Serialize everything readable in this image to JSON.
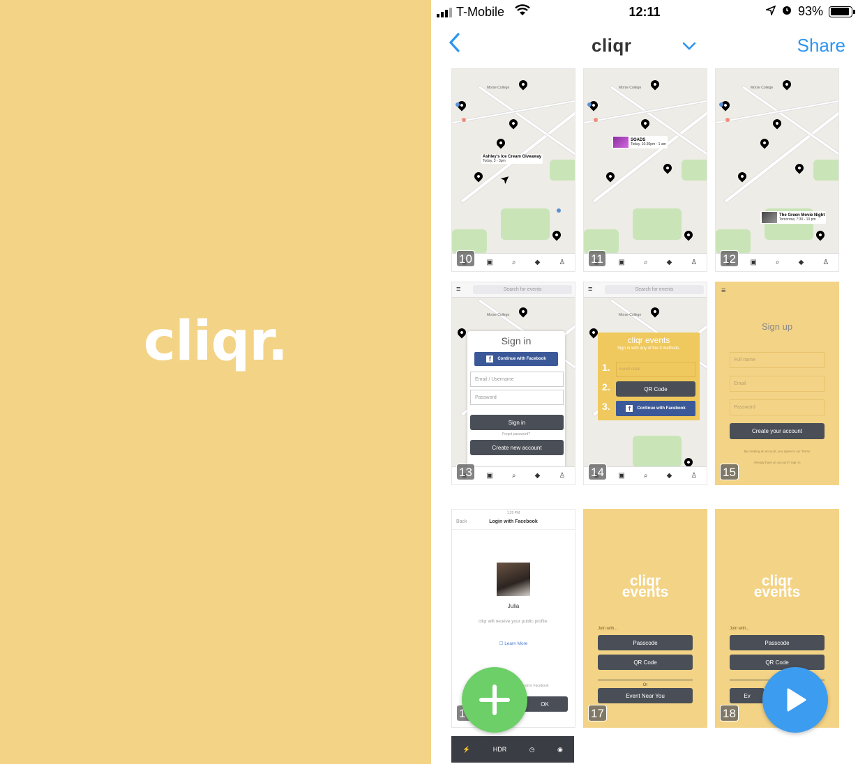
{
  "splash": {
    "logo": "cliqr."
  },
  "status": {
    "carrier": "T-Mobile",
    "time": "12:11",
    "battery": "93%",
    "battery_level": 0.93
  },
  "nav": {
    "back": "‹",
    "title": "cliqr",
    "chevron": "⌄",
    "share": "Share"
  },
  "tiles": {
    "t10": {
      "num": "10",
      "callout_title": "Ashley's Ice Cream Giveaway",
      "callout_sub": "Today, 3 - 3pm"
    },
    "t11": {
      "num": "11",
      "callout_title": "SOADS",
      "callout_sub": "Today, 10:30pm - 1 am"
    },
    "t12": {
      "num": "12",
      "callout_title": "The Green Movie Night",
      "callout_sub": "Tomorrow, 7:30 - 10 pm"
    },
    "t13": {
      "num": "13",
      "search": "Search for events",
      "title": "Sign in",
      "fb": "Continue with Facebook",
      "user": "Email / Username",
      "pass": "Password",
      "signin": "Sign in",
      "forgot": "Forgot password?",
      "create": "Create new account"
    },
    "t14": {
      "num": "14",
      "search": "Search for events",
      "title": "cliqr events",
      "sub": "Sign in with any of the 3 methods.",
      "n1": "1.",
      "n2": "2.",
      "n3": "3.",
      "code": "Event code",
      "qr": "QR Code",
      "fb": "Continue with Facebook"
    },
    "t15": {
      "num": "15",
      "title": "Sign up",
      "full": "Full name",
      "email": "Email",
      "pass": "Password",
      "create": "Create your account",
      "terms": "By creating an account, you agree to our Terms",
      "have": "Already have an account? Sign in"
    },
    "t16": {
      "num": "16",
      "status_time": "1:20 PM",
      "back": "Back",
      "head": "Login with Facebook",
      "name": "Julia",
      "desc": "cliqr will receive your public profile.",
      "learn": "Learn More",
      "ok": "OK",
      "foot": "ed to Facebook"
    },
    "t17": {
      "num": "17",
      "w1": "cliqr",
      "w2": "events",
      "join": "Join with...",
      "pass": "Passcode",
      "qr": "QR Code",
      "or": "Or",
      "near": "Event Near You"
    },
    "t18": {
      "num": "18",
      "w1": "cliqr",
      "w2": "events",
      "join": "Join with...",
      "pass": "Passcode",
      "qr": "QR Code",
      "near": "Ev"
    }
  },
  "tabbar": {
    "labels": [
      "Join",
      "Create",
      "Find",
      "Tags",
      "Account"
    ]
  },
  "camera": {
    "hdr": "HDR"
  },
  "icons": {
    "back": "chevron-left-icon",
    "chevron": "chevron-down-icon",
    "add": "plus-icon",
    "play": "play-icon"
  },
  "colors": {
    "yellow": "#f3d386",
    "accent": "#2e95f0",
    "green": "#6dcf67",
    "facebook": "#3b5998"
  }
}
